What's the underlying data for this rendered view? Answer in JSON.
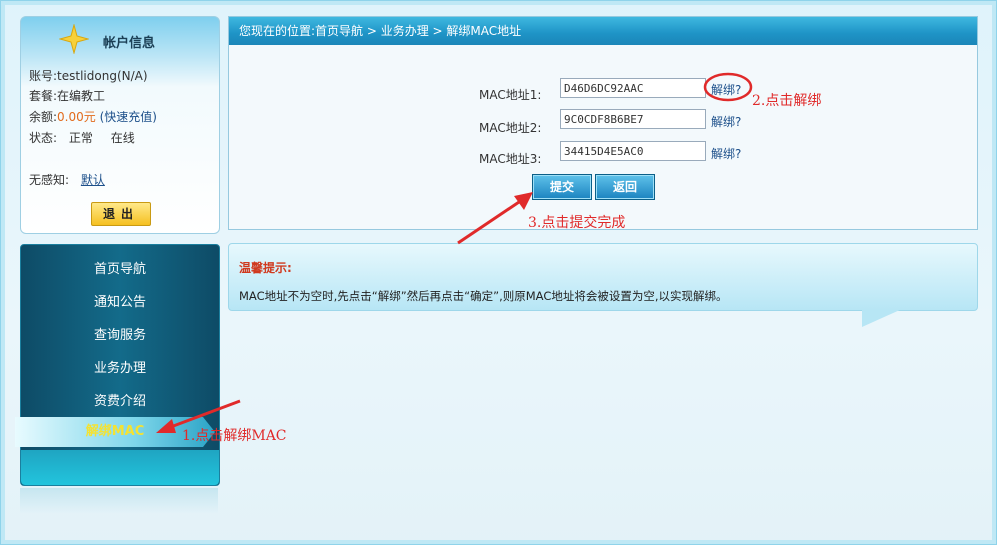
{
  "account": {
    "title": "帐户信息",
    "account_label": "账号:",
    "account_value": "testlidong(N/A)",
    "plan_label": "套餐:",
    "plan_value": "在编教工",
    "balance_label": "余额:",
    "balance_value": "0.00元",
    "recharge": "(快速充值)",
    "status_label": "状态:",
    "status_value": "正常",
    "online_value": "在线",
    "noninductive_label": "无感知:",
    "noninductive_value": "默认",
    "logout": "退出"
  },
  "nav": {
    "items": [
      "首页导航",
      "通知公告",
      "查询服务",
      "业务办理",
      "资费介绍"
    ],
    "active": "解绑MAC"
  },
  "breadcrumb": "您现在的位置:首页导航 > 业务办理 > 解绑MAC地址",
  "form": {
    "rows": [
      {
        "label": "MAC地址1:",
        "value": "D46D6DC92AAC",
        "link": "解绑?"
      },
      {
        "label": "MAC地址2:",
        "value": "9C0CDF8B6BE7",
        "link": "解绑?"
      },
      {
        "label": "MAC地址3:",
        "value": "34415D4E5AC0",
        "link": "解绑?"
      }
    ],
    "submit": "提交",
    "back": "返回"
  },
  "tip": {
    "title": "温馨提示:",
    "body": "MAC地址不为空时,先点击“解绑”然后再点击“确定”,则原MAC地址将会被设置为空,以实现解绑。"
  },
  "annotations": {
    "step1": "1.点击解绑MAC",
    "step2": "2.点击解绑",
    "step3": "3.点击提交完成"
  },
  "colors": {
    "annotation": "#e02a2a",
    "header_bar": "#1e93c6",
    "balance": "#e26b1c"
  }
}
